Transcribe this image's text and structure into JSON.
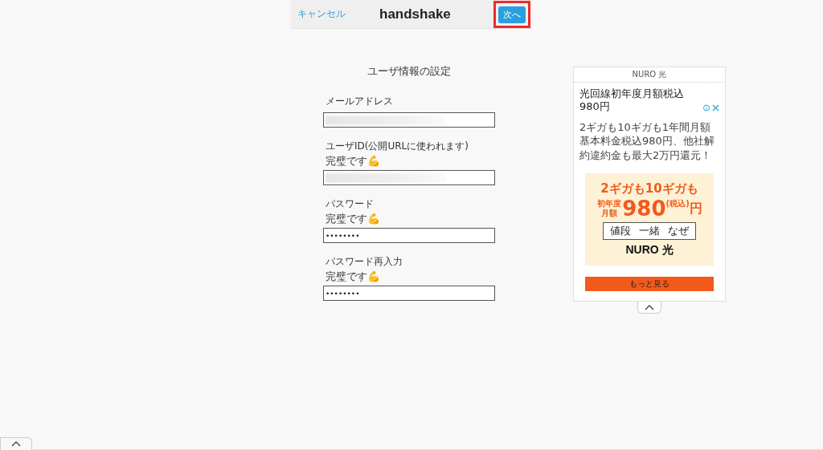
{
  "header": {
    "cancel": "キャンセル",
    "title": "handshake",
    "next": {
      "label": "次へ",
      "highlighted": true
    }
  },
  "form": {
    "title": "ユーザ情報の設定",
    "fields": [
      {
        "label": "メールアドレス",
        "kind": "blurred"
      },
      {
        "label": "ユーザID(公開URLに使われます)",
        "status": "完璧です💪",
        "kind": "blurred"
      },
      {
        "label": "パスワード",
        "status": "完璧です💪",
        "kind": "password",
        "value": "••••••••"
      },
      {
        "label": "パスワード再入力",
        "status": "完璧です💪",
        "kind": "password",
        "value": "••••••••"
      }
    ]
  },
  "ad": {
    "sponsor": "NURO 光",
    "headline": "光回線初年度月額税込980円",
    "body": "2ギガも10ギガも1年間月額基本料金税込980円、他社解約違約金も最大2万円還元！",
    "banner": {
      "line1": "2ギガも10ギガも",
      "prefix": "初年度月額",
      "price": "980",
      "unit": "円",
      "tax": "(税込)",
      "words": [
        "値段",
        "一緒",
        "なぜ"
      ],
      "brand": "NURO 光"
    },
    "button": "もっと見る"
  }
}
